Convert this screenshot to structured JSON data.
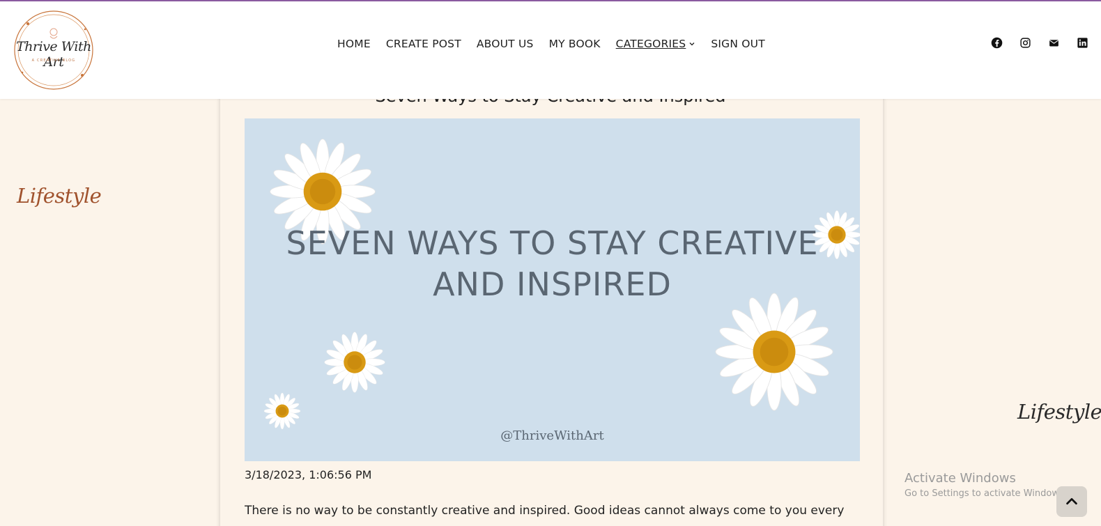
{
  "brand": {
    "logo_title": "Thrive With Art",
    "logo_subtitle": "A CREATIVE BLOG"
  },
  "nav": {
    "items": [
      {
        "label": "HOME"
      },
      {
        "label": "CREATE POST"
      },
      {
        "label": "ABOUT US"
      },
      {
        "label": "MY BOOK"
      },
      {
        "label": "CATEGORIES",
        "has_dropdown": true
      },
      {
        "label": "SIGN OUT"
      }
    ]
  },
  "social": [
    "facebook-icon",
    "instagram-icon",
    "mail-icon",
    "linkedin-icon"
  ],
  "sidebar": {
    "left_label": "Lifestyle",
    "right_label": "Lifestyle"
  },
  "post": {
    "title": "Seven Ways to Stay Creative and Inspired",
    "hero_title": "SEVEN WAYS TO STAY CREATIVE AND INSPIRED",
    "hero_handle": "@ThriveWithArt",
    "date": "3/18/2023, 1:06:56 PM",
    "body": "There is no way to be constantly creative and inspired. Good ideas cannot always come to you every"
  },
  "watermark": {
    "line1": "Activate Windows",
    "line2": "Go to Settings to activate Windows."
  },
  "colors": {
    "page_bg": "#fcf4ea",
    "hero_bg": "#cfdfec",
    "accent_brown": "#a0522d",
    "top_line": "#8a5aa0"
  }
}
